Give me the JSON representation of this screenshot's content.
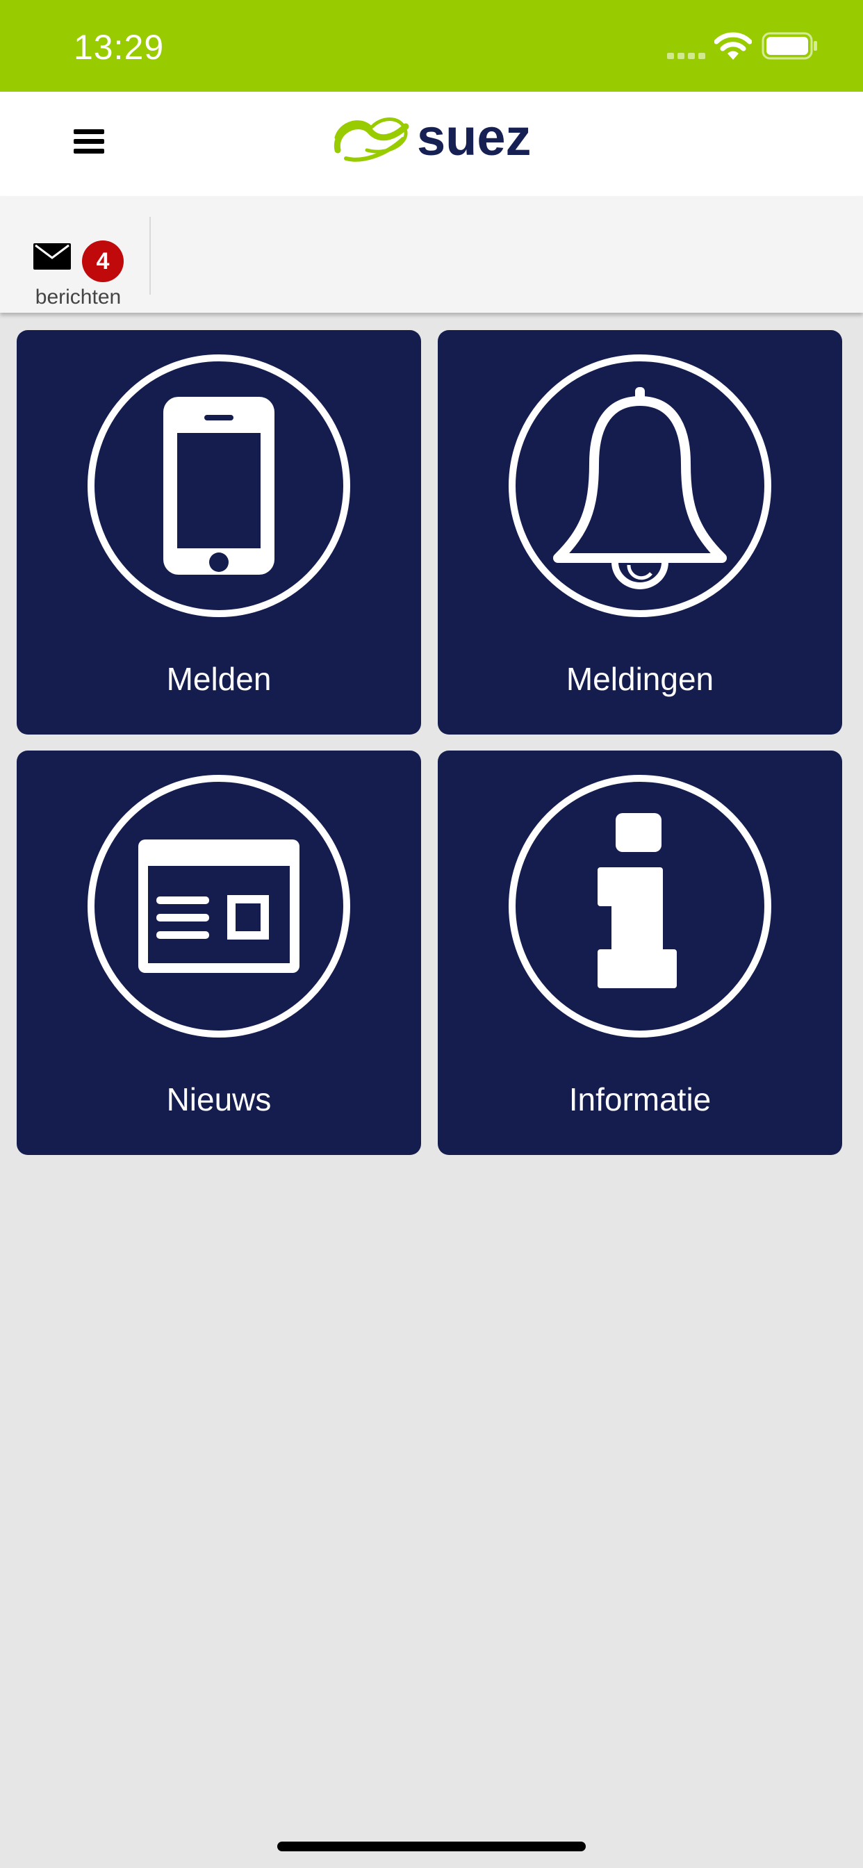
{
  "status_bar": {
    "time": "13:29",
    "background_color": "#99cc00"
  },
  "header": {
    "menu_icon": "hamburger-menu-icon",
    "logo_text": "suez",
    "logo_icon": "suez-swirl-logo",
    "logo_color": "#162052",
    "logo_accent_color": "#99cc00"
  },
  "toolbar": {
    "messages": {
      "icon": "mail-icon",
      "badge_count": "4",
      "label": "berichten",
      "badge_color": "#c0090b"
    }
  },
  "tiles": [
    {
      "id": "melden",
      "label": "Melden",
      "icon": "smartphone-icon"
    },
    {
      "id": "meldingen",
      "label": "Meldingen",
      "icon": "bell-icon"
    },
    {
      "id": "nieuws",
      "label": "Nieuws",
      "icon": "newspaper-icon"
    },
    {
      "id": "informatie",
      "label": "Informatie",
      "icon": "info-icon"
    }
  ],
  "colors": {
    "tile_background": "#141d4e",
    "page_background": "#e6e6e6"
  }
}
